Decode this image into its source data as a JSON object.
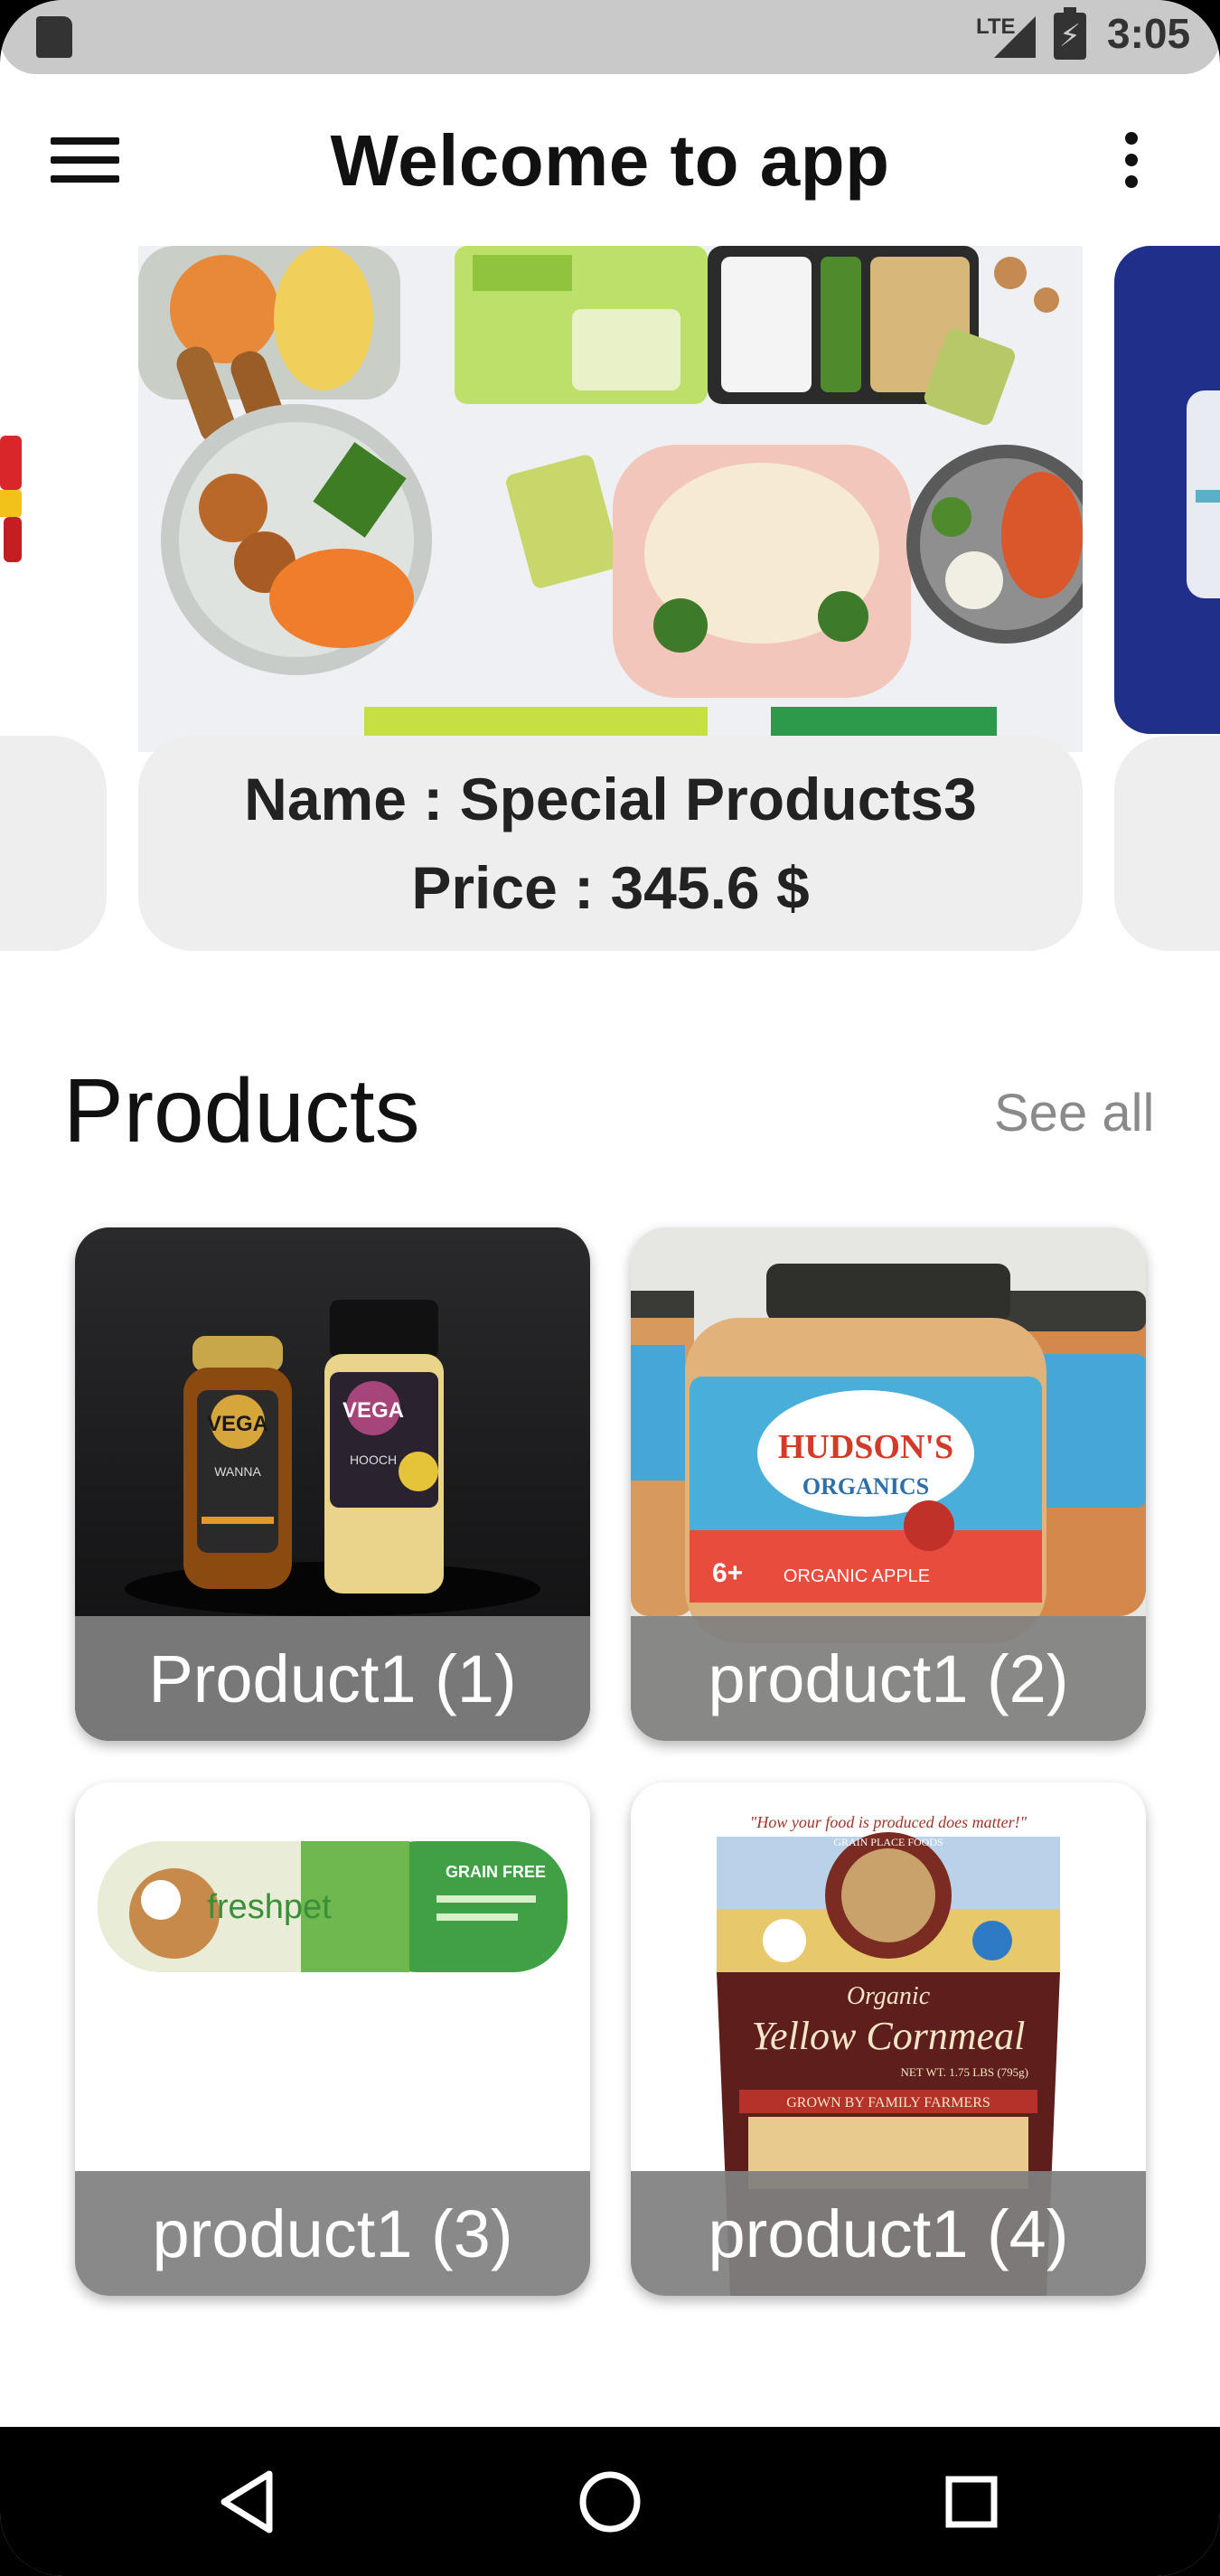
{
  "status_bar": {
    "network": "LTE",
    "time": "3:05"
  },
  "app_bar": {
    "title": "Welcome to app"
  },
  "carousel": {
    "active": {
      "name_label": "Name : Special Products3",
      "price_label": "Price :  345.6 $"
    }
  },
  "products": {
    "title": "Products",
    "see_all": "See all",
    "items": [
      {
        "label": "Product1 (1)"
      },
      {
        "label": "product1 (2)"
      },
      {
        "label": "product1 (3)"
      },
      {
        "label": "product1 (4)"
      }
    ]
  },
  "cornmeal_pack": {
    "tagline": "\"How your food is produced does matter!\"",
    "brand": "GRAIN PLACE FOODS",
    "organic": "Organic",
    "product": "Yellow Cornmeal",
    "net": "NET WT. 1.75 LBS (795g)",
    "banner": "GROWN BY FAMILY FARMERS"
  },
  "jar": {
    "brand_top": "HUDSON'S",
    "brand_bottom": "ORGANICS",
    "badge": "6+",
    "flavor": "ORGANIC APPLE"
  },
  "vega": {
    "left": "VEGA",
    "right": "VEGA",
    "left_sub": "WANNA",
    "right_sub": "HOOCH"
  },
  "freshpet": {
    "brand": "freshpet",
    "tag": "GRAIN FREE"
  },
  "colors": {
    "label_bg": "#808080",
    "info_bg": "#eeeeee",
    "see_all": "#8a8a8a",
    "status_bar": "#c9c9c9"
  }
}
